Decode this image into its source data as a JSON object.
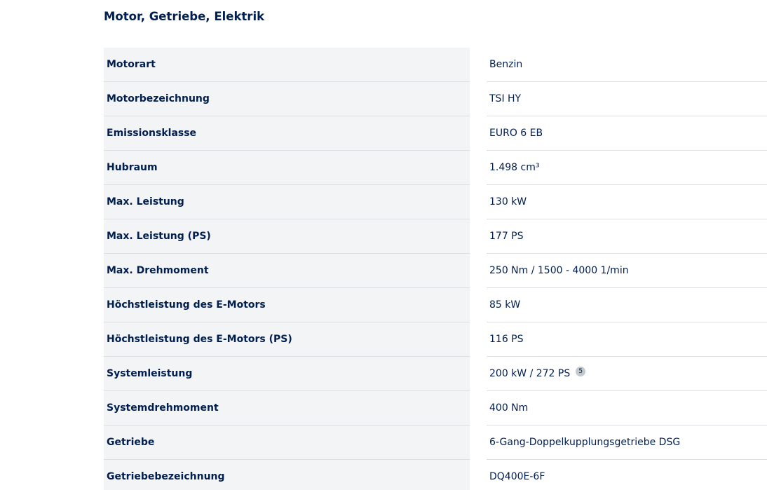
{
  "section": {
    "title": "Motor, Getriebe, Elektrik"
  },
  "rows": [
    {
      "label": "Motorart",
      "value": "Benzin"
    },
    {
      "label": "Motorbezeichnung",
      "value": "TSI HY"
    },
    {
      "label": "Emissionsklasse",
      "value": "EURO 6 EB"
    },
    {
      "label": "Hubraum",
      "value": "1.498 cm³"
    },
    {
      "label": "Max. Leistung",
      "value": "130 kW"
    },
    {
      "label": "Max. Leistung (PS)",
      "value": "177 PS"
    },
    {
      "label": "Max. Drehmoment",
      "value": "250 Nm / 1500 - 4000 1/min"
    },
    {
      "label": "Höchstleistung des E-Motors",
      "value": "85 kW"
    },
    {
      "label": "Höchstleistung des E-Motors (PS)",
      "value": "116 PS"
    },
    {
      "label": "Systemleistung",
      "value": "200 kW / 272 PS",
      "footnote": "5"
    },
    {
      "label": "Systemdrehmoment",
      "value": "400 Nm"
    },
    {
      "label": "Getriebe",
      "value": "6-Gang-Doppelkupplungsgetriebe DSG"
    },
    {
      "label": "Getriebebezeichnung",
      "value": "DQ400E-6F"
    }
  ],
  "colors": {
    "text": "#001e50",
    "label_background": "#f2f4f6",
    "divider": "#dcdfe3",
    "footnote_badge": "#c2cacf"
  }
}
